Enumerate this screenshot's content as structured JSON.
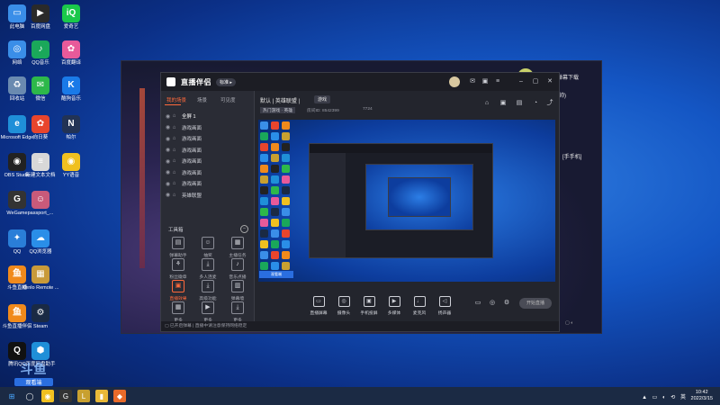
{
  "desktop": {
    "icons": [
      {
        "label": "此电脑",
        "color": "#3a8ee8",
        "glyph": "▭"
      },
      {
        "label": "网络",
        "color": "#3a8ee8",
        "glyph": "◎"
      },
      {
        "label": "回收站",
        "color": "#6a8ab0",
        "glyph": "♻"
      },
      {
        "label": "Microsoft Edge",
        "color": "#1f8fd8",
        "glyph": "e"
      },
      {
        "label": "OBS Studio",
        "color": "#222222",
        "glyph": "◉"
      },
      {
        "label": "WeGame",
        "color": "#333333",
        "glyph": "G"
      },
      {
        "label": "QQ",
        "color": "#2a7ed8",
        "glyph": "✦"
      },
      {
        "label": "斗鱼直播",
        "color": "#f08a1c",
        "glyph": "鱼"
      },
      {
        "label": "斗鱼直播伴侣",
        "color": "#f08a1c",
        "glyph": "鱼"
      },
      {
        "label": "腾讯QQ",
        "color": "#111111",
        "glyph": "Q"
      },
      {
        "label": "百度网盘",
        "color": "#2a2a2a",
        "glyph": "▶"
      },
      {
        "label": "QQ音乐",
        "color": "#1aa85a",
        "glyph": "♪"
      },
      {
        "label": "微信",
        "color": "#2db84a",
        "glyph": "✉"
      },
      {
        "label": "向日葵",
        "color": "#e8452c",
        "glyph": "✿"
      },
      {
        "label": "新建文本文档",
        "color": "#d8d8d8",
        "glyph": "≡"
      },
      {
        "label": "passport_...",
        "color": "#c85a7a",
        "glyph": "☺"
      },
      {
        "label": "QQ浏览器",
        "color": "#2a8ee8",
        "glyph": "☁"
      },
      {
        "label": "Kenlo Remote ...",
        "color": "#c89a3a",
        "glyph": "▦"
      },
      {
        "label": "Steam",
        "color": "#1a2a44",
        "glyph": "⚙"
      },
      {
        "label": "百度网盘助手",
        "color": "#1f8fd8",
        "glyph": "⬢"
      },
      {
        "label": "爱奇艺",
        "color": "#1ac84a",
        "glyph": "iQ"
      },
      {
        "label": "百度翻译",
        "color": "#e85a9a",
        "glyph": "✿"
      },
      {
        "label": "酷狗音乐",
        "color": "#1a7ae8",
        "glyph": "K"
      },
      {
        "label": "帕尔",
        "color": "#223355",
        "glyph": "N"
      },
      {
        "label": "YY语音",
        "color": "#f0c020",
        "glyph": "◉"
      }
    ]
  },
  "watermark": {
    "brand": "斗鱼",
    "tag": "观看端",
    "room": "8542399"
  },
  "app": {
    "logo": "直播伴侣",
    "version": "标准 ▸",
    "left_tabs": [
      "我的场景",
      "场景",
      "可见度"
    ],
    "scenes": [
      "全屏 1",
      "游戏画面",
      "游戏画面",
      "游戏画面",
      "游戏画面",
      "游戏画面",
      "游戏画面",
      "英雄联盟"
    ],
    "tools_title": "工具箱",
    "tools": [
      "弹幕助手",
      "抽奖",
      "主播任务",
      "粉丝徽章",
      "多人连麦",
      "音乐点播",
      "直播效果",
      "高级功能",
      "弹幕墙",
      "更多",
      "更多",
      "更多"
    ],
    "header": {
      "title": "默认 | 英雄联盟 |",
      "badge": "游戏",
      "room_label": "房间ID: 8542399",
      "room_number": "8542399",
      "viewers": "7724",
      "category": "热门游戏 · 英雄"
    },
    "bottom_tools": [
      "直播屏幕",
      "摄像头",
      "手机投屏",
      "多媒体",
      "麦克风",
      "扬声器"
    ],
    "go_live": "开始直播",
    "status": "▢ 已开启弹幕 | 直播中请注意保持网络稳定"
  },
  "chat": {
    "lines": [
      "弹幕下载",
      "(帅)",
      "[手手机]"
    ]
  },
  "taskbar": {
    "time": "10:42",
    "date": "2022/3/15"
  }
}
